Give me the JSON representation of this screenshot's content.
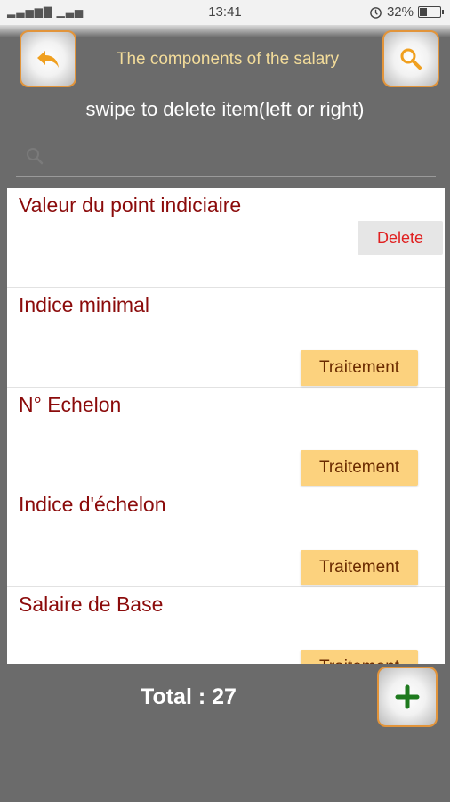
{
  "status": {
    "time": "13:41",
    "battery": "32%",
    "battery_level": 0.32
  },
  "header": {
    "title": "The components of the salary"
  },
  "subtitle": "swipe to delete item(left or right)",
  "search": {
    "placeholder": ""
  },
  "items": [
    {
      "title": "Valeur du point indiciaire",
      "action": "Delete"
    },
    {
      "title": "Indice minimal",
      "action": "Traitement"
    },
    {
      "title": "N° Echelon",
      "action": "Traitement"
    },
    {
      "title": "Indice d'échelon",
      "action": "Traitement"
    },
    {
      "title": "Salaire de Base",
      "action": "Traitement"
    }
  ],
  "footer": {
    "total": "Total : 27"
  },
  "colors": {
    "accent": "#e2943a",
    "title": "#f3dc9a",
    "item_text": "#8b0b0b",
    "button": "#fcd27e",
    "delete_text": "#e02020",
    "add": "#1e7a1e"
  },
  "icons": {
    "back": "reply-arrow-icon",
    "search": "search-icon",
    "add": "plus-icon"
  }
}
